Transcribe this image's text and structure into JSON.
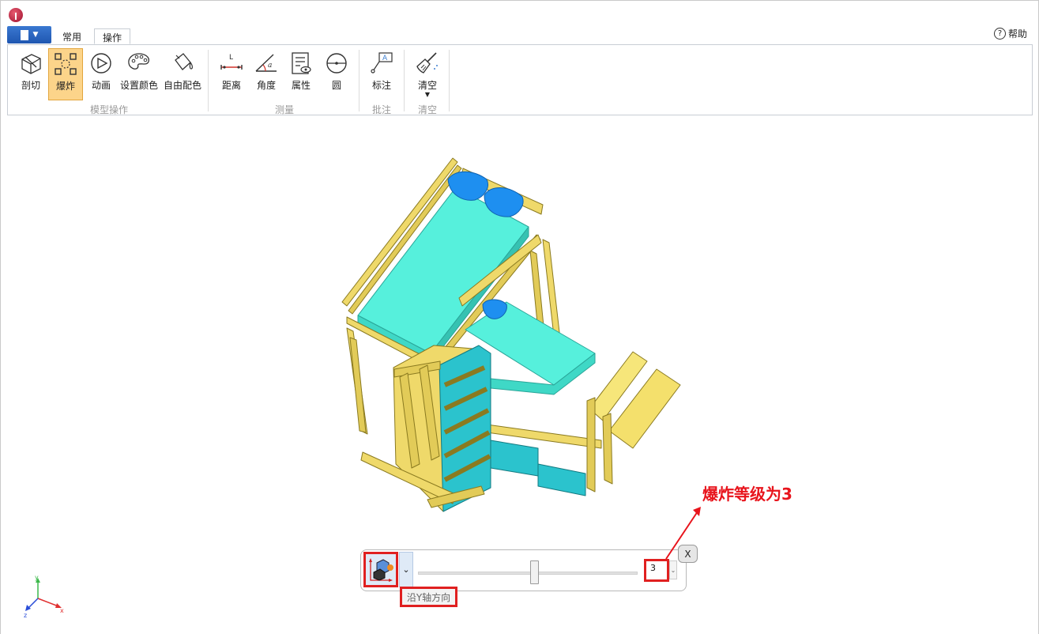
{
  "app": {
    "logo": "app-logo-icon"
  },
  "file_menu": {
    "icon": "document-icon"
  },
  "tabs": [
    {
      "label": "常用",
      "active": false
    },
    {
      "label": "操作",
      "active": true
    }
  ],
  "help": {
    "label": "帮助",
    "icon": "question-icon"
  },
  "ribbon": {
    "groups": [
      {
        "label": "模型操作",
        "buttons": [
          {
            "label": "剖切",
            "icon": "section-cube-icon"
          },
          {
            "label": "爆炸",
            "icon": "explode-icon",
            "active": true
          },
          {
            "label": "动画",
            "icon": "play-circle-icon"
          },
          {
            "label": "设置颜色",
            "icon": "palette-icon"
          },
          {
            "label": "自由配色",
            "icon": "paint-bucket-icon"
          }
        ]
      },
      {
        "label": "测量",
        "buttons": [
          {
            "label": "距离",
            "icon": "distance-icon"
          },
          {
            "label": "角度",
            "icon": "angle-icon"
          },
          {
            "label": "属性",
            "icon": "properties-icon"
          },
          {
            "label": "圆",
            "icon": "circle-icon"
          }
        ]
      },
      {
        "label": "批注",
        "buttons": [
          {
            "label": "标注",
            "icon": "annotation-icon"
          }
        ]
      },
      {
        "label": "清空",
        "buttons": [
          {
            "label": "清空",
            "icon": "broom-icon"
          }
        ]
      }
    ]
  },
  "explode_panel": {
    "axis_icon": "explode-axis-icon",
    "slider_fraction": 0.53,
    "level_value": "3",
    "close_label": "X",
    "tooltip": "沿Y轴方向"
  },
  "annotation": {
    "text": "爆炸等级为3"
  },
  "triad": {
    "x": "x",
    "y": "y",
    "z": "z"
  },
  "colors": {
    "accent_highlight": "#fcd48a",
    "annotation_red": "#e8141c",
    "wood": "#f1df67",
    "mattress": "#56f0dc",
    "pillow": "#1e8ff0",
    "drawer": "#2bc3cd"
  }
}
